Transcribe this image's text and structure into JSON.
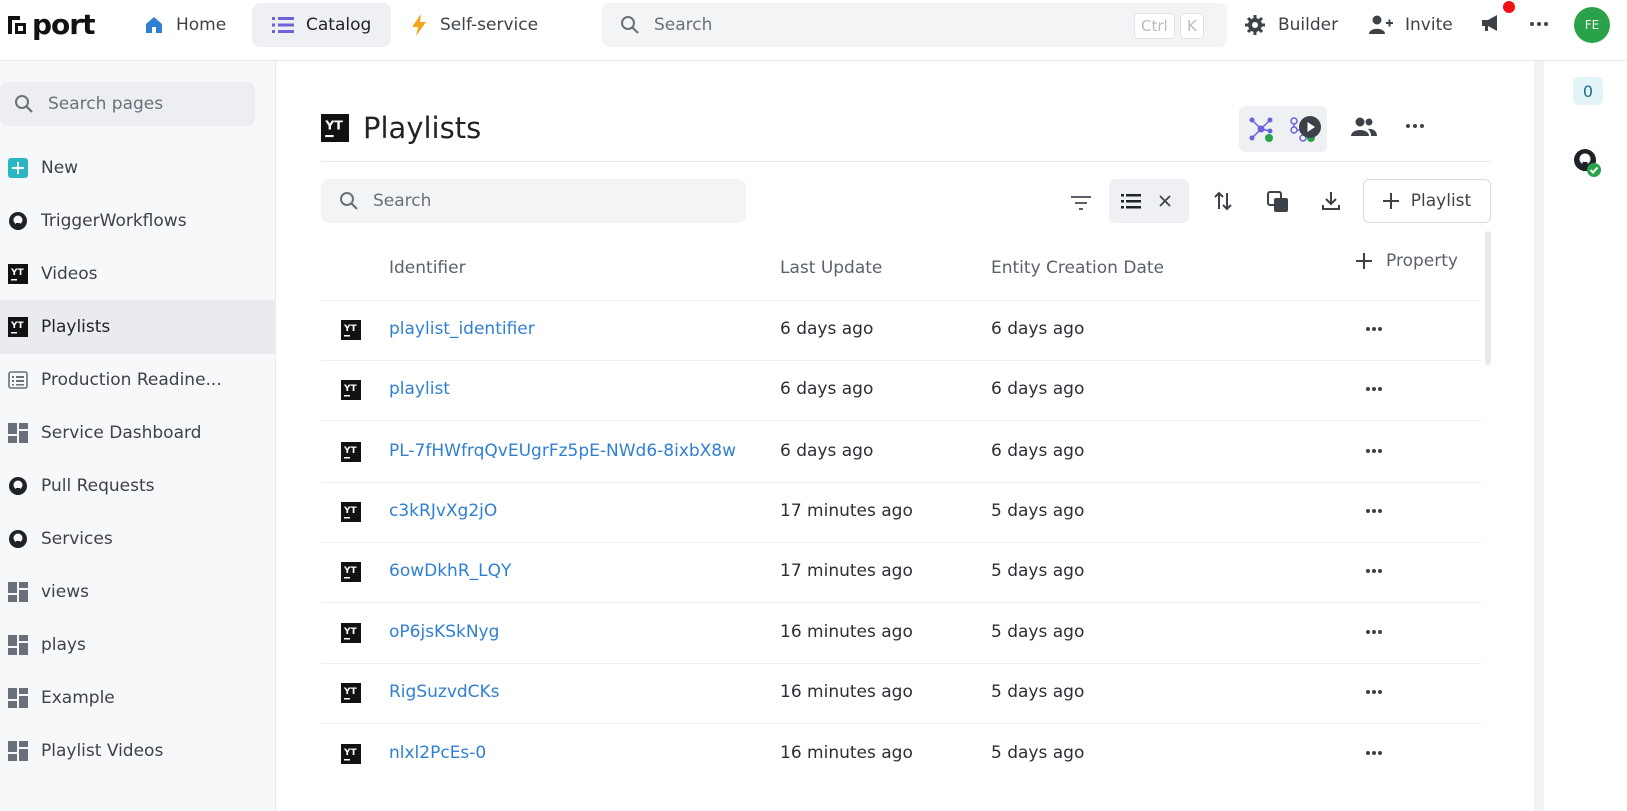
{
  "topbar": {
    "logo_text": "port",
    "nav": [
      {
        "label": "Home",
        "icon": "home-icon"
      },
      {
        "label": "Catalog",
        "icon": "list-icon"
      },
      {
        "label": "Self-service",
        "icon": "lightning-icon"
      }
    ],
    "search": {
      "placeholder": "Search",
      "shortcut_ctrl": "Ctrl",
      "shortcut_key": "K"
    },
    "builder_label": "Builder",
    "invite_label": "Invite",
    "avatar_initials": "FE",
    "avatar_color": "#2aa24a"
  },
  "sidebar": {
    "search_placeholder": "Search pages",
    "items": [
      {
        "label": "New",
        "icon": "plus-square-icon"
      },
      {
        "label": "TriggerWorkflows",
        "icon": "github-icon"
      },
      {
        "label": "Videos",
        "icon": "youtube-icon"
      },
      {
        "label": "Playlists",
        "icon": "youtube-icon"
      },
      {
        "label": "Production Readine...",
        "icon": "scorecard-icon"
      },
      {
        "label": "Service Dashboard",
        "icon": "dashboard-icon"
      },
      {
        "label": "Pull Requests",
        "icon": "github-icon"
      },
      {
        "label": "Services",
        "icon": "github-icon"
      },
      {
        "label": "views",
        "icon": "dashboard-icon"
      },
      {
        "label": "plays",
        "icon": "dashboard-icon"
      },
      {
        "label": "Example",
        "icon": "dashboard-icon"
      },
      {
        "label": "Playlist Videos",
        "icon": "dashboard-icon"
      }
    ]
  },
  "main": {
    "title": "Playlists",
    "table_search_placeholder": "Search",
    "add_button_label": "Playlist",
    "columns": {
      "identifier": "Identifier",
      "last_update": "Last Update",
      "created": "Entity Creation Date",
      "add_property": "Property"
    },
    "rows": [
      {
        "identifier": "playlist_identifier",
        "last_update": "6 days ago",
        "created": "6 days ago"
      },
      {
        "identifier": "playlist",
        "last_update": "6 days ago",
        "created": "6 days ago"
      },
      {
        "identifier": "PL-7fHWfrqQvEUgrFz5pE-NWd6-8ixbX8w",
        "last_update": "6 days ago",
        "created": "6 days ago"
      },
      {
        "identifier": "c3kRJvXg2jO",
        "last_update": "17 minutes ago",
        "created": "5 days ago"
      },
      {
        "identifier": "6owDkhR_LQY",
        "last_update": "17 minutes ago",
        "created": "5 days ago"
      },
      {
        "identifier": "oP6jsKSkNyg",
        "last_update": "16 minutes ago",
        "created": "5 days ago"
      },
      {
        "identifier": "RigSuzvdCKs",
        "last_update": "16 minutes ago",
        "created": "5 days ago"
      },
      {
        "identifier": "nlxl2PcEs-0",
        "last_update": "16 minutes ago",
        "created": "5 days ago"
      }
    ]
  },
  "rail": {
    "count": "0"
  },
  "colors": {
    "link": "#2f7fd3",
    "accent_green": "#2aa24a",
    "notification_red": "#f30f16"
  }
}
